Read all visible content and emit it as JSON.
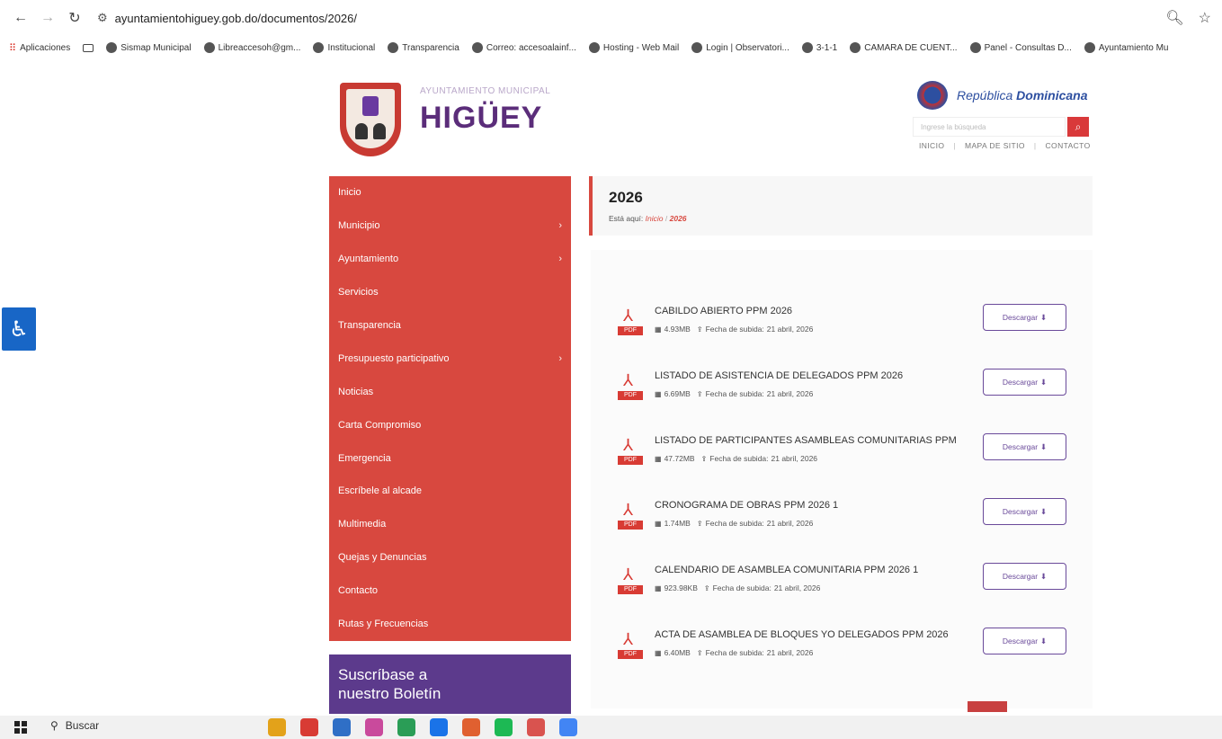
{
  "browser": {
    "url": "ayuntamientohiguey.gob.do/documentos/2026/",
    "bookmarks": [
      "Aplicaciones",
      "",
      "Sismap Municipal",
      "Libreaccesoh@gm...",
      "Institucional",
      "Transparencia",
      "Correo: accesoalainf...",
      "Hosting - Web Mail",
      "Login | Observatori...",
      "3-1-1",
      "CAMARA DE CUENT...",
      "Panel - Consultas D...",
      "Ayuntamiento Mu"
    ]
  },
  "header": {
    "subtitle": "AYUNTAMIENTO MUNICIPAL",
    "title": "HIGÜEY",
    "gov_left": "República",
    "gov_right": "Dominicana",
    "search_placeholder": "Ingrese la búsqueda",
    "links": [
      "INICIO",
      "MAPA DE SITIO",
      "CONTACTO"
    ]
  },
  "sidebar": {
    "items": [
      {
        "label": "Inicio",
        "chevron": false
      },
      {
        "label": "Municipio",
        "chevron": true
      },
      {
        "label": "Ayuntamiento",
        "chevron": true
      },
      {
        "label": "Servicios",
        "chevron": false
      },
      {
        "label": "Transparencia",
        "chevron": false
      },
      {
        "label": "Presupuesto participativo",
        "chevron": true
      },
      {
        "label": "Noticias",
        "chevron": false
      },
      {
        "label": "Carta Compromiso",
        "chevron": false
      },
      {
        "label": "Emergencia",
        "chevron": false
      },
      {
        "label": "Escríbele al alcade",
        "chevron": false
      },
      {
        "label": "Multimedia",
        "chevron": false
      },
      {
        "label": "Quejas y Denuncias",
        "chevron": false
      },
      {
        "label": "Contacto",
        "chevron": false
      },
      {
        "label": "Rutas y Frecuencias",
        "chevron": false
      }
    ],
    "newsletter_line1": "Suscríbase a",
    "newsletter_line2": "nuestro Boletín"
  },
  "main": {
    "title": "2026",
    "breadcrumb_prefix": "Está aquí:",
    "breadcrumb_link": "Inicio",
    "breadcrumb_sep": "/",
    "breadcrumb_current": "2026",
    "pdf_label": "PDF",
    "upload_label": "Fecha de subida:",
    "download_label": "Descargar",
    "documents": [
      {
        "name": "CABILDO ABIERTO PPM 2026",
        "size": "4.93MB",
        "date": "21 abril, 2026"
      },
      {
        "name": "LISTADO DE ASISTENCIA DE DELEGADOS PPM 2026",
        "size": "6.69MB",
        "date": "21 abril, 2026"
      },
      {
        "name": "LISTADO DE PARTICIPANTES ASAMBLEAS COMUNITARIAS PPM",
        "size": "47.72MB",
        "date": "21 abril, 2026"
      },
      {
        "name": "CRONOGRAMA DE OBRAS PPM 2026 1",
        "size": "1.74MB",
        "date": "21 abril, 2026"
      },
      {
        "name": "CALENDARIO DE ASAMBLEA COMUNITARIA PPM 2026 1",
        "size": "923.98KB",
        "date": "21 abril, 2026"
      },
      {
        "name": "ACTA DE ASAMBLEA DE BLOQUES YO DELEGADOS PPM 2026",
        "size": "6.40MB",
        "date": "21 abril, 2026"
      }
    ]
  },
  "taskbar": {
    "search_label": "Buscar",
    "app_colors": [
      "#e3a21a",
      "#d83b34",
      "#2f6fc6",
      "#c94a9c",
      "#2a9d56",
      "#1a73e8",
      "#e06030",
      "#1db954",
      "#d9534f",
      "#4285f4"
    ]
  }
}
